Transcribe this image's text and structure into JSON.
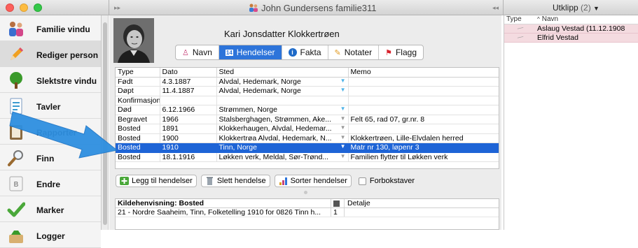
{
  "window": {
    "title": "John Gundersens familie311",
    "nav_left": "▸▸",
    "nav_right": "◂◂"
  },
  "sidebar": {
    "items": [
      {
        "label": "Familie vindu",
        "icon": "family-icon"
      },
      {
        "label": "Rediger person",
        "icon": "pencil-icon"
      },
      {
        "label": "Slektstre vindu",
        "icon": "tree-icon"
      },
      {
        "label": "Tavler",
        "icon": "document-icon"
      },
      {
        "label": "Rapporter",
        "icon": "report-icon"
      },
      {
        "label": "Finn",
        "icon": "magnifier-icon"
      },
      {
        "label": "Endre",
        "icon": "switch-icon"
      },
      {
        "label": "Marker",
        "icon": "checkmark-icon"
      },
      {
        "label": "Logger",
        "icon": "log-icon"
      }
    ]
  },
  "person": {
    "name": "Kari Jonsdatter Klokkertrøen"
  },
  "tabs": [
    {
      "label": "Navn",
      "icon": "person-icon"
    },
    {
      "label": "Hendelser",
      "icon": "calendar-icon"
    },
    {
      "label": "Fakta",
      "icon": "info-icon"
    },
    {
      "label": "Notater",
      "icon": "note-icon"
    },
    {
      "label": "Flagg",
      "icon": "flag-icon"
    }
  ],
  "events": {
    "columns": [
      "Type",
      "Dato",
      "Sted",
      "Memo"
    ],
    "rows": [
      {
        "type": "Født",
        "date": "4.3.1887",
        "place": "Alvdal, Hedemark, Norge",
        "memo": ""
      },
      {
        "type": "Døpt",
        "date": "11.4.1887",
        "place": "Alvdal, Hedemark, Norge",
        "memo": ""
      },
      {
        "type": "Konfirmasjon",
        "date": "",
        "place": "",
        "memo": ""
      },
      {
        "type": "Død",
        "date": "6.12.1966",
        "place": "Strømmen, Norge",
        "memo": ""
      },
      {
        "type": "Begravet",
        "date": "1966",
        "place": "Stalsberghagen, Strømmen, Ake...",
        "memo": "Felt 65, rad 07, gr.nr. 8"
      },
      {
        "type": "Bosted",
        "date": "1891",
        "place": "Klokkerhaugen, Alvdal, Hedemar...",
        "memo": ""
      },
      {
        "type": "Bosted",
        "date": "1900",
        "place": "Klokkertrøa Alvdal, Hedemark, N...",
        "memo": "Klokkertrøen, Lille-Elvdalen herred"
      },
      {
        "type": "Bosted",
        "date": "1910",
        "place": "Tinn, Norge",
        "memo": "Matr nr 130, løpenr 3"
      },
      {
        "type": "Bosted",
        "date": "18.1.1916",
        "place": "Løkken verk, Meldal, Sør-Trønd...",
        "memo": "Familien flytter til Løkken verk"
      }
    ]
  },
  "buttons": {
    "add": "Legg til hendelser",
    "delete": "Slett hendelse",
    "sort": "Sorter hendelser",
    "checkbox": "Forbokstaver"
  },
  "source": {
    "header": "Kildehenvisning: Bosted",
    "detail_header": "Detalje",
    "rows": [
      {
        "text": "21 - Nordre Saaheim, Tinn, Folketelling 1910 for 0826 Tinn h...",
        "num": "1",
        "detail": ""
      }
    ]
  },
  "clippings": {
    "title": "Utklipp",
    "count": "(2)",
    "columns": [
      "Type",
      "Navn"
    ],
    "rows": [
      {
        "name": "Aslaug Vestad (11.12.1908"
      },
      {
        "name": "Elfrid Vestad"
      }
    ]
  }
}
